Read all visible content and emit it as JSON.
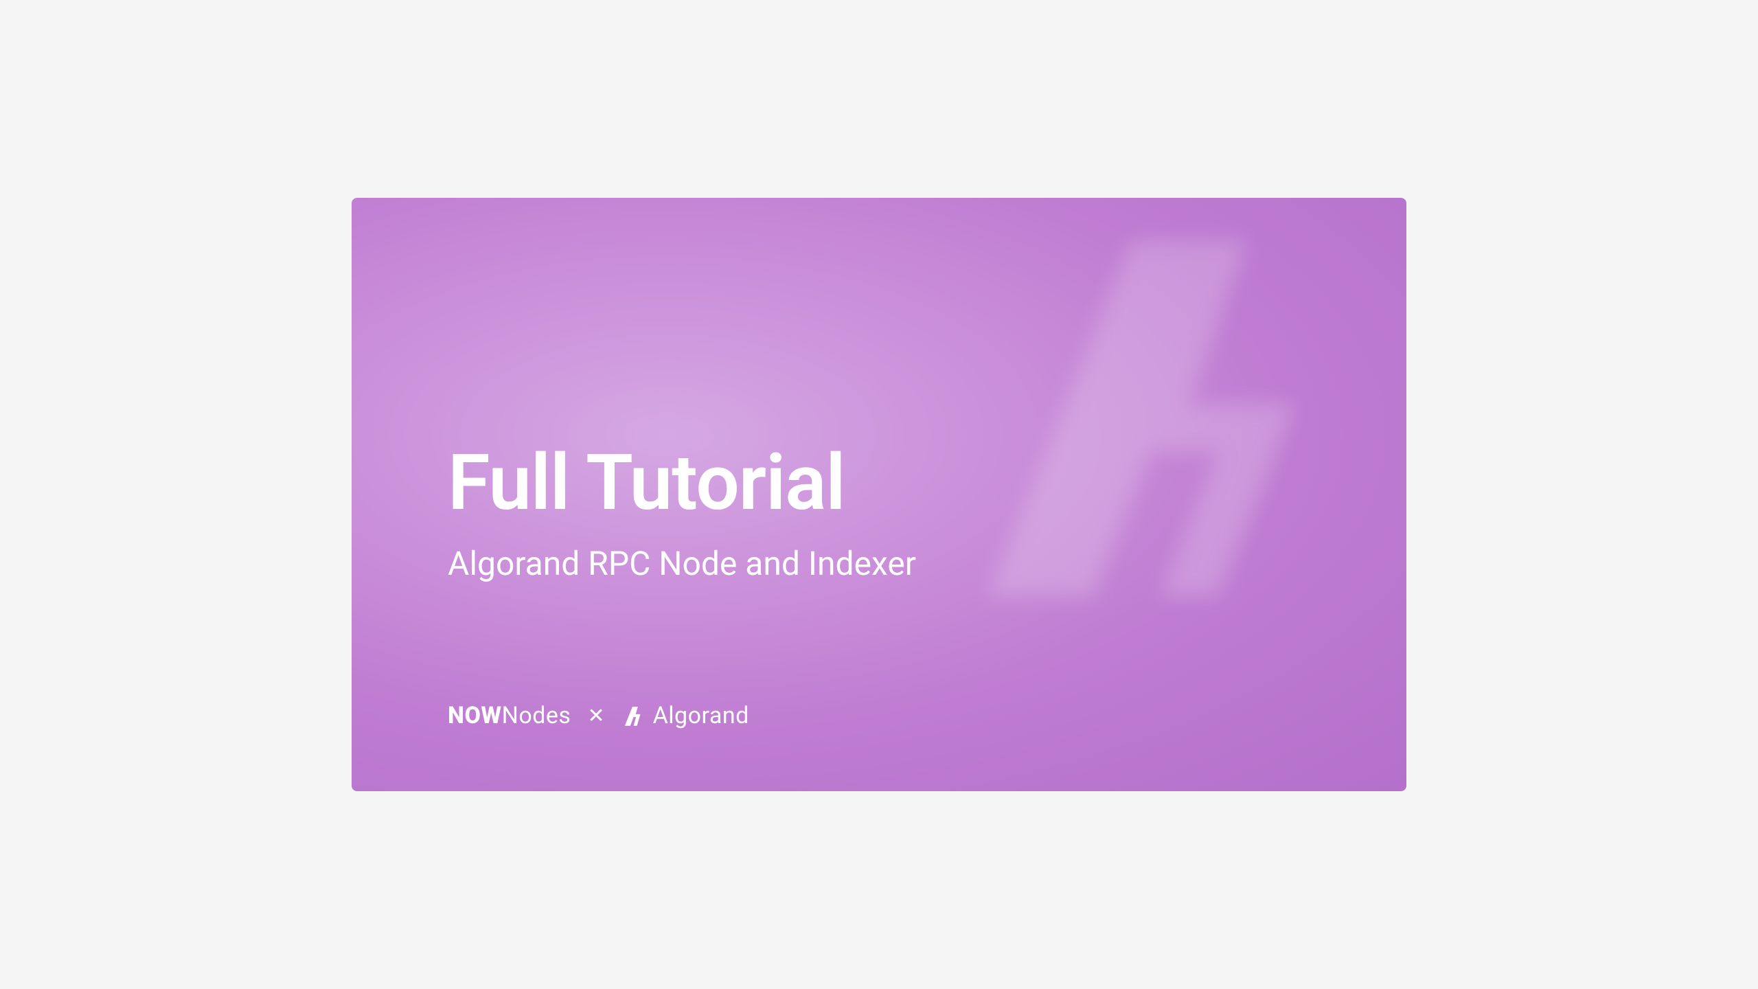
{
  "title": "Full Tutorial",
  "subtitle": "Algorand RPC Node and Indexer",
  "logos": {
    "nownodes_bold": "NOW",
    "nownodes_light": "Nodes",
    "separator": "✕",
    "algorand": "Algorand"
  }
}
